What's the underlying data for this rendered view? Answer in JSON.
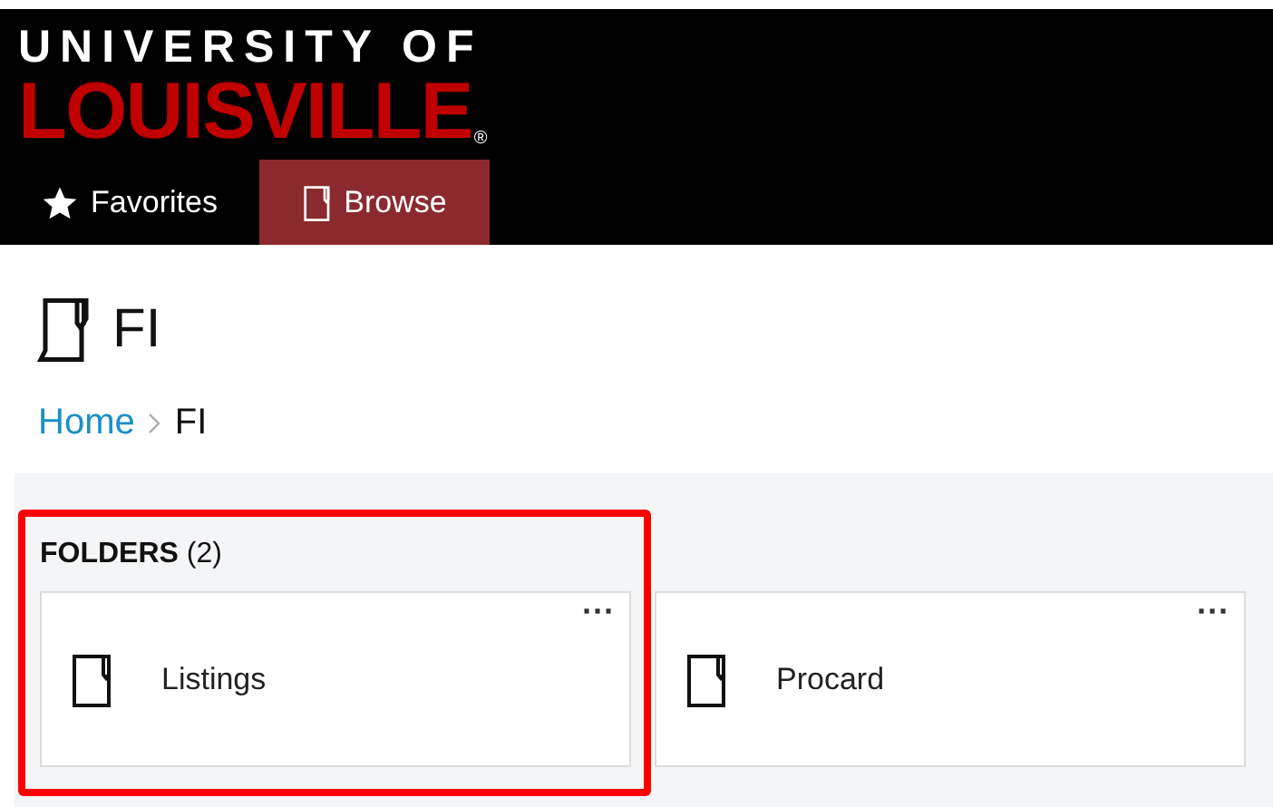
{
  "header": {
    "logo_top": "UNIVERSITY OF",
    "logo_main": "LOUISVILLE",
    "logo_mark": "®"
  },
  "tabs": [
    {
      "label": "Favorites",
      "kind": "favorites",
      "selected": false
    },
    {
      "label": "Browse",
      "kind": "browse",
      "selected": true
    }
  ],
  "page": {
    "title": "FI"
  },
  "breadcrumb": [
    {
      "label": "Home",
      "kind": "link"
    },
    {
      "label": "FI",
      "kind": "current"
    }
  ],
  "folders": {
    "heading": "FOLDERS",
    "count": "(2)",
    "items": [
      {
        "name": "Listings",
        "menu": "···"
      },
      {
        "name": "Procard",
        "menu": "···"
      }
    ]
  }
}
